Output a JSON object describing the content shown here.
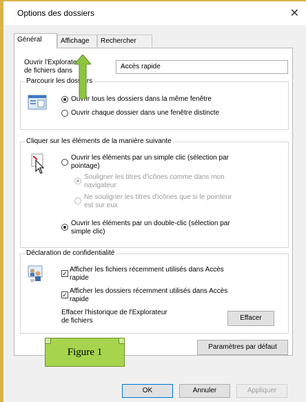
{
  "window": {
    "title": "Options des dossiers",
    "close": "✕"
  },
  "tabs": [
    {
      "label": "Général",
      "active": true
    },
    {
      "label": "Affichage",
      "active": false
    },
    {
      "label": "Rechercher",
      "active": false
    }
  ],
  "open_explorer": {
    "label_line1": "Ouvrir l'Explorateur",
    "label_line2": "de fichiers dans",
    "selected": "Accès rapide"
  },
  "browse": {
    "title": "Parcourir les dossiers",
    "option_same": "Ouvrir tous les dossiers dans la même fenêtre",
    "option_new": "Ouvrir chaque dossier dans une fenêtre distincte",
    "selected": "same"
  },
  "click": {
    "title": "Cliquer sur les éléments de la manière suivante",
    "single_line1": "Ouvrir les éléments par un simple clic (sélection par",
    "single_line2": "pointage)",
    "underline_browser_line1": "Souligner les titres d'icônes comme dans mon",
    "underline_browser_line2": "navigateur",
    "underline_hover_line1": "Ne souligner les titres d'icônes que si le pointeur",
    "underline_hover_line2": "est sur eux",
    "double_line1": "Ouvrir les éléments par un double-clic (sélection par",
    "double_line2": "simple clic)",
    "selected": "double"
  },
  "privacy": {
    "title": "Déclaration de confidentialité",
    "recent_files_line1": "Afficher les fichiers récemment utilisés dans Accès",
    "recent_files_line2": "rapide",
    "recent_folders_line1": "Afficher les dossiers récemment utilisés dans Accès",
    "recent_folders_line2": "rapide",
    "clear_history_line1": "Effacer l'historique de l'Explorateur",
    "clear_history_line2": "de fichiers",
    "clear_button": "Effacer",
    "check_mark": "✓"
  },
  "defaults_button": "Paramètres par défaut",
  "footer": {
    "ok": "OK",
    "cancel": "Annuler",
    "apply": "Appliquer"
  },
  "annotation": {
    "figure_label": "Figure 1",
    "arrow_color": "#8dc63f"
  }
}
